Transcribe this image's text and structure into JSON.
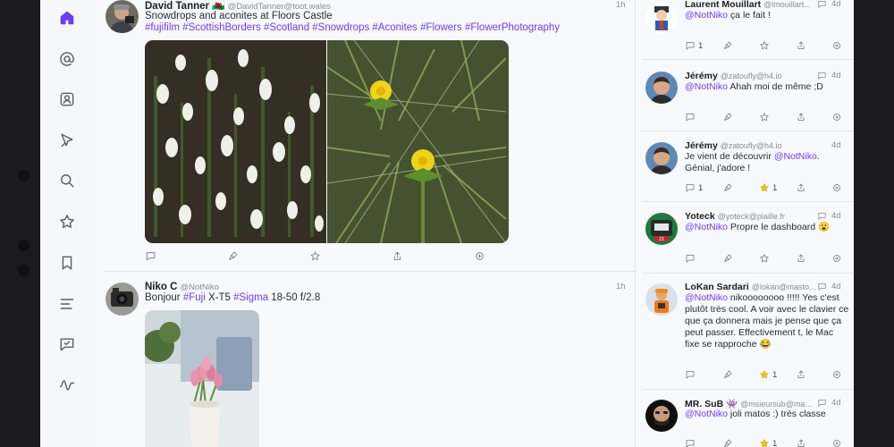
{
  "colors": {
    "accent": "#6b3cf5",
    "star": "#f2c200"
  },
  "sidebar": {
    "items": [
      {
        "icon": "home-icon"
      },
      {
        "icon": "mention-icon"
      },
      {
        "icon": "profile-icon"
      },
      {
        "icon": "explore-icon"
      },
      {
        "icon": "search-icon"
      },
      {
        "icon": "favourites-icon"
      },
      {
        "icon": "bookmarks-icon"
      },
      {
        "icon": "lists-icon"
      },
      {
        "icon": "messages-icon"
      },
      {
        "icon": "activity-icon"
      }
    ]
  },
  "timeline": {
    "posts": [
      {
        "name": "David Tanner 🏴󠁧󠁢󠁷󠁬󠁳󠁿",
        "handle": "@DavidTanner@toot.wales",
        "time": "1h",
        "text": "Snowdrops and aconites at Floors Castle",
        "tags": "#fujifilm #ScottishBorders #Scotland #Snowdrops #Aconites #Flowers #FlowerPhotography",
        "images": [
          "snowdrops-photo",
          "aconite-photo"
        ]
      },
      {
        "name": "Niko C",
        "handle": "@NotNiko",
        "time": "1h",
        "text_before": "Bonjour ",
        "tag1": "#Fuji",
        "text_mid": " X-T5 ",
        "tag2": "#Sigma",
        "text_after": " 18-50 f/2.8",
        "images": [
          "tulips-photo"
        ]
      }
    ]
  },
  "notifications": [
    {
      "name": "Laurent Mouillart",
      "handle": "@lmouillart...",
      "time": "4d",
      "mention": "@NotNiko",
      "text": " ça le fait !",
      "replies": "1",
      "favs": ""
    },
    {
      "name": "Jérémy",
      "handle": "@zatoufly@h4.io",
      "time": "4d",
      "mention": "@NotNiko",
      "text": " Ahah moi de même ;D",
      "replies": "",
      "favs": ""
    },
    {
      "name": "Jérémy",
      "handle": "@zatoufly@h4.io",
      "time": "4d",
      "prefix": "Je vient de découvrir ",
      "mention": "@NotNiko",
      "text": ". Génial, j'adore !",
      "replies": "1",
      "favs": "1"
    },
    {
      "name": "Yoteck",
      "handle": "@yoteck@piaille.fr",
      "time": "4d",
      "mention": "@NotNiko",
      "text": " Propre le dashboard 😮",
      "replies": "",
      "favs": ""
    },
    {
      "name": "LoKan Sardari",
      "handle": "@lokan@masto...",
      "time": "4d",
      "mention": "@NotNiko",
      "text": " nikoooooooo !!!!! Yes c'est plutôt très cool. A voir avec le clavier ce que ça donnera mais je pense que ça peut passer. Effectivement t, le Mac fixe se rapproche 😂",
      "replies": "",
      "favs": "1"
    },
    {
      "name": "MR. SuB 👾",
      "handle": "@msieursub@ma...",
      "time": "4d",
      "mention": "@NotNiko",
      "text": " joli matos :) très classe",
      "replies": "",
      "favs": "1"
    }
  ]
}
